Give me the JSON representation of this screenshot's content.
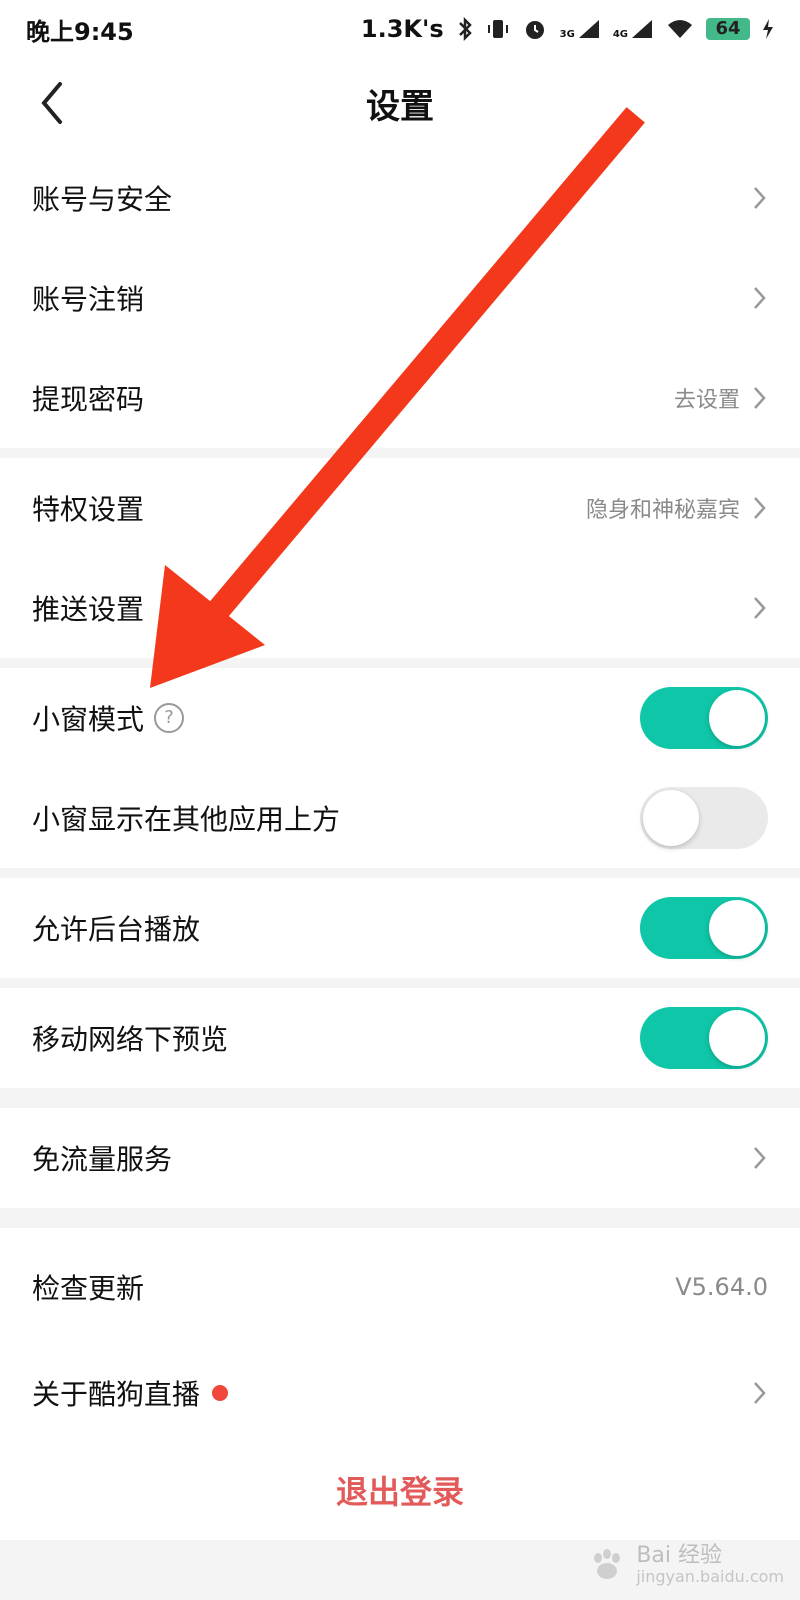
{
  "status": {
    "time": "晚上9:45",
    "network_speed": "1.3K's",
    "net3g": "3G",
    "net4g": "4G",
    "battery": "64"
  },
  "header": {
    "title": "设置"
  },
  "sections": {
    "account": {
      "items": [
        {
          "label": "账号与安全"
        },
        {
          "label": "账号注销"
        },
        {
          "label": "提现密码",
          "value": "去设置"
        }
      ]
    },
    "privilege": {
      "items": [
        {
          "label": "特权设置",
          "value": "隐身和神秘嘉宾"
        },
        {
          "label": "推送设置"
        }
      ]
    },
    "mini": {
      "items": [
        {
          "label": "小窗模式",
          "help": "?",
          "toggle": true
        },
        {
          "label": "小窗显示在其他应用上方",
          "toggle": false
        }
      ]
    },
    "background": {
      "label": "允许后台播放",
      "toggle": true
    },
    "mobile_preview": {
      "label": "移动网络下预览",
      "toggle": true
    },
    "free_traffic": {
      "label": "免流量服务"
    },
    "about": {
      "items": [
        {
          "label": "检查更新",
          "value": "V5.64.0"
        },
        {
          "label": "关于酷狗直播"
        }
      ]
    }
  },
  "logout": {
    "label": "退出登录"
  },
  "watermark": {
    "brand": "Bai",
    "brand2": "经验",
    "url": "jingyan.baidu.com"
  },
  "colors": {
    "accent": "#0fc7a8",
    "arrow": "#f3381b",
    "logout": "#e35a5a",
    "dot": "#f0473a"
  }
}
